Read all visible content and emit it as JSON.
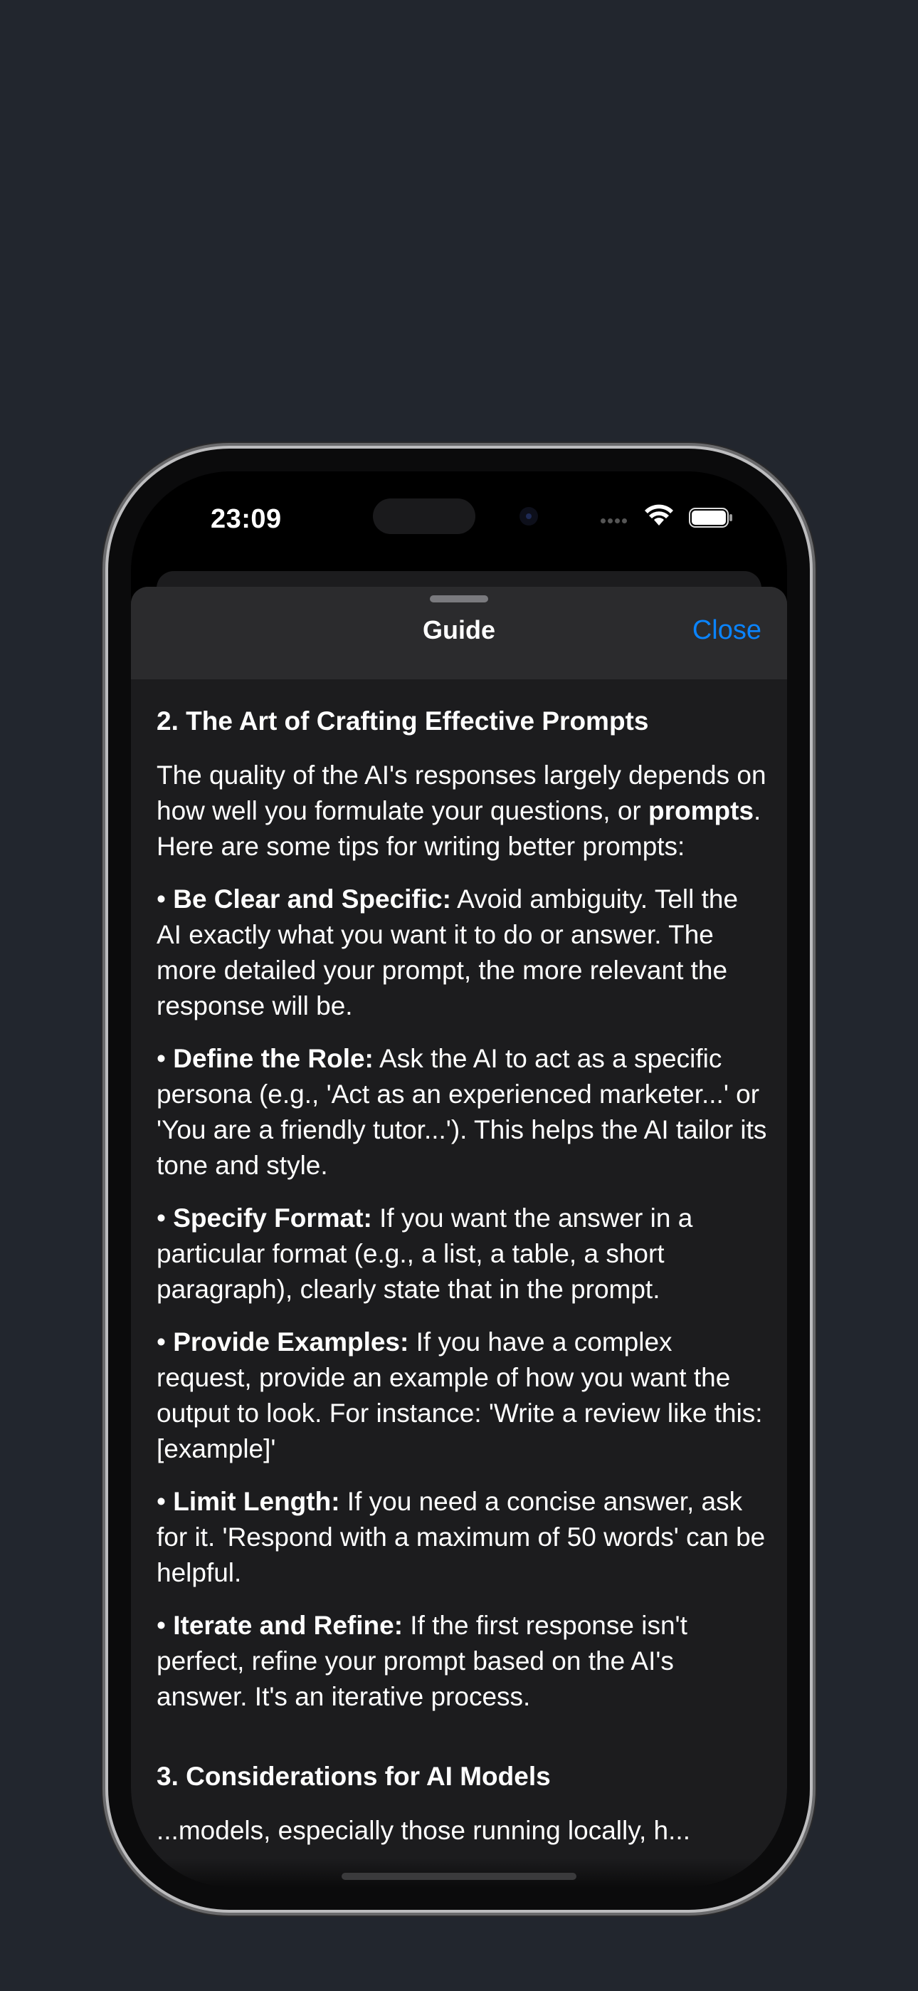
{
  "status_bar": {
    "time": "23:09"
  },
  "sheet": {
    "title": "Guide",
    "close_label": "Close"
  },
  "content": {
    "section2_heading": "2. The Art of Crafting Effective Prompts",
    "intro": {
      "pre": "The quality of the AI's responses largely depends on how well you formulate your questions, or ",
      "bold": "prompts",
      "post": ". Here are some tips for writing better prompts:"
    },
    "tips": [
      {
        "bullet": "• ",
        "title": "Be Clear and Specific:",
        "text": " Avoid ambiguity. Tell the AI exactly what you want it to do or answer. The more detailed your prompt, the more relevant the response will be."
      },
      {
        "bullet": "• ",
        "title": "Define the Role:",
        "text": " Ask the AI to act as a specific persona (e.g., 'Act as an experienced marketer...' or 'You are a friendly tutor...'). This helps the AI tailor its tone and style."
      },
      {
        "bullet": "• ",
        "title": "Specify Format:",
        "text": " If you want the answer in a particular format (e.g., a list, a table, a short paragraph), clearly state that in the prompt."
      },
      {
        "bullet": "• ",
        "title": "Provide Examples:",
        "text": " If you have a complex request, provide an example of how you want the output to look. For instance: 'Write a review like this: [example]'"
      },
      {
        "bullet": "• ",
        "title": "Limit Length:",
        "text": " If you need a concise answer, ask for it. 'Respond with a maximum of 50 words' can be helpful."
      },
      {
        "bullet": "• ",
        "title": "Iterate and Refine:",
        "text": " If the first response isn't perfect, refine your prompt based on the AI's answer. It's an iterative process."
      }
    ],
    "section3_heading": "3. Considerations for AI Models",
    "section3_partial": "...models, especially those running locally, h..."
  },
  "colors": {
    "background": "#22262e",
    "sheet": "#1c1c1e",
    "header": "#2b2b2d",
    "accent": "#0a84ff",
    "text": "#ffffff"
  },
  "icons": [
    "wifi-icon",
    "battery-icon",
    "signal-icon"
  ]
}
